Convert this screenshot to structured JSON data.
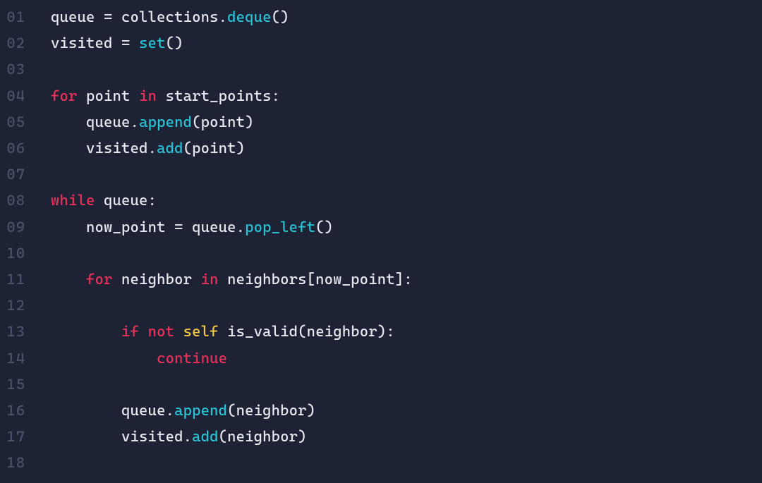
{
  "colors": {
    "background": "#1e2235",
    "gutter": "#4b5269",
    "default": "#e7e9ef",
    "keyword": "#e9315a",
    "function": "#29c3d6",
    "self": "#f2c744"
  },
  "code": {
    "lines": [
      {
        "num": "01",
        "indent": 0,
        "tokens": [
          {
            "s": "def",
            "t": "queue = collections."
          },
          {
            "s": "fn",
            "t": "deque"
          },
          {
            "s": "def",
            "t": "()"
          }
        ]
      },
      {
        "num": "02",
        "indent": 0,
        "tokens": [
          {
            "s": "def",
            "t": "visited = "
          },
          {
            "s": "fn",
            "t": "set"
          },
          {
            "s": "def",
            "t": "()"
          }
        ]
      },
      {
        "num": "03",
        "indent": 0,
        "tokens": []
      },
      {
        "num": "04",
        "indent": 0,
        "tokens": [
          {
            "s": "kw",
            "t": "for"
          },
          {
            "s": "def",
            "t": " point "
          },
          {
            "s": "kw",
            "t": "in"
          },
          {
            "s": "def",
            "t": " start_points:"
          }
        ]
      },
      {
        "num": "05",
        "indent": 1,
        "tokens": [
          {
            "s": "def",
            "t": "queue."
          },
          {
            "s": "fn",
            "t": "append"
          },
          {
            "s": "def",
            "t": "(point)"
          }
        ]
      },
      {
        "num": "06",
        "indent": 1,
        "tokens": [
          {
            "s": "def",
            "t": "visited."
          },
          {
            "s": "fn",
            "t": "add"
          },
          {
            "s": "def",
            "t": "(point)"
          }
        ]
      },
      {
        "num": "07",
        "indent": 0,
        "tokens": []
      },
      {
        "num": "08",
        "indent": 0,
        "tokens": [
          {
            "s": "kw",
            "t": "while"
          },
          {
            "s": "def",
            "t": " queue:"
          }
        ]
      },
      {
        "num": "09",
        "indent": 1,
        "tokens": [
          {
            "s": "def",
            "t": "now_point = queue."
          },
          {
            "s": "fn",
            "t": "pop_left"
          },
          {
            "s": "def",
            "t": "()"
          }
        ]
      },
      {
        "num": "10",
        "indent": 0,
        "tokens": []
      },
      {
        "num": "11",
        "indent": 1,
        "tokens": [
          {
            "s": "kw",
            "t": "for"
          },
          {
            "s": "def",
            "t": " neighbor "
          },
          {
            "s": "kw",
            "t": "in"
          },
          {
            "s": "def",
            "t": " neighbors[now_point]:"
          }
        ]
      },
      {
        "num": "12",
        "indent": 0,
        "tokens": []
      },
      {
        "num": "13",
        "indent": 2,
        "tokens": [
          {
            "s": "kw",
            "t": "if"
          },
          {
            "s": "def",
            "t": " "
          },
          {
            "s": "kw",
            "t": "not"
          },
          {
            "s": "def",
            "t": " "
          },
          {
            "s": "self",
            "t": "self"
          },
          {
            "s": "def",
            "t": " is_valid(neighbor):"
          }
        ]
      },
      {
        "num": "14",
        "indent": 3,
        "tokens": [
          {
            "s": "kw",
            "t": "continue"
          }
        ]
      },
      {
        "num": "15",
        "indent": 0,
        "tokens": []
      },
      {
        "num": "16",
        "indent": 2,
        "tokens": [
          {
            "s": "def",
            "t": "queue."
          },
          {
            "s": "fn",
            "t": "append"
          },
          {
            "s": "def",
            "t": "(neighbor)"
          }
        ]
      },
      {
        "num": "17",
        "indent": 2,
        "tokens": [
          {
            "s": "def",
            "t": "visited."
          },
          {
            "s": "fn",
            "t": "add"
          },
          {
            "s": "def",
            "t": "(neighbor)"
          }
        ]
      },
      {
        "num": "18",
        "indent": 0,
        "tokens": []
      }
    ]
  },
  "code_plain": "queue = collections.deque()\nvisited = set()\n\nfor point in start_points:\n    queue.append(point)\n    visited.add(point)\n\nwhile queue:\n    now_point = queue.pop_left()\n\n    for neighbor in neighbors[now_point]:\n\n        if not self is_valid(neighbor):\n            continue\n\n        queue.append(neighbor)\n        visited.add(neighbor)\n"
}
